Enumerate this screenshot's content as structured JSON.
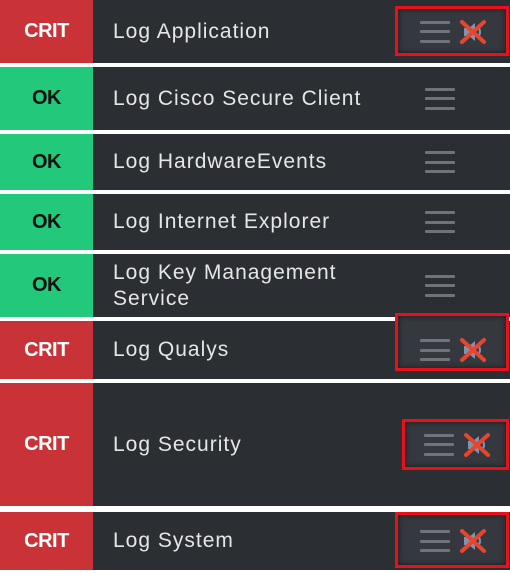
{
  "services": [
    {
      "state": "CRIT",
      "name": "Log Application",
      "highlighted": true,
      "muted": true
    },
    {
      "state": "OK",
      "name": "Log Cisco Secure Client",
      "highlighted": false,
      "muted": false
    },
    {
      "state": "OK",
      "name": "Log HardwareEvents",
      "highlighted": false,
      "muted": false
    },
    {
      "state": "OK",
      "name": "Log Internet Explorer",
      "highlighted": false,
      "muted": false
    },
    {
      "state": "OK",
      "name": "Log Key Management Service",
      "highlighted": false,
      "muted": false
    },
    {
      "state": "CRIT",
      "name": "Log Qualys",
      "highlighted": true,
      "muted": true
    },
    {
      "state": "CRIT",
      "name": "Log Security",
      "highlighted": true,
      "muted": true
    },
    {
      "state": "CRIT",
      "name": "Log System",
      "highlighted": true,
      "muted": true
    }
  ],
  "colors": {
    "crit": "#c93338",
    "ok": "#22c97b",
    "row_bg": "#2b2e33",
    "highlight": "#e8101a"
  },
  "icons": {
    "menu": "hamburger-menu-icon",
    "mute": "speaker-muted-icon"
  }
}
